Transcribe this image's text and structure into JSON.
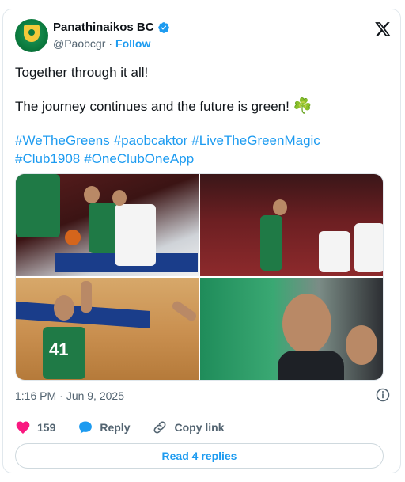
{
  "author": {
    "display_name": "Panathinaikos BC",
    "handle": "@Paobcgr",
    "separator": "·",
    "follow_label": "Follow",
    "avatar_text": "PANATHINAIKOS BC AKTOR",
    "verified_color": "#1d9bf0"
  },
  "tweet": {
    "line1": "Together through it all!",
    "line2": "The journey continues and the future is green!",
    "emoji": "☘️",
    "hashtags_row1": [
      "#WeTheGreens",
      "#paobcaktor",
      "#LiveTheGreenMagic"
    ],
    "hashtags_row2": [
      "#Club1908",
      "#OneClubOneApp"
    ]
  },
  "media": {
    "photos": [
      {
        "alt_icon": "photo-basketball-dribble",
        "jersey": ""
      },
      {
        "alt_icon": "photo-layup",
        "jersey": ""
      },
      {
        "alt_icon": "photo-shot",
        "jersey": "41"
      },
      {
        "alt_icon": "photo-coach",
        "jersey": ""
      }
    ]
  },
  "meta": {
    "time": "1:16 PM",
    "separator": "·",
    "date": "Jun 9, 2025"
  },
  "actions": {
    "like_count": "159",
    "reply_label": "Reply",
    "copy_link_label": "Copy link"
  },
  "footer": {
    "read_replies_label": "Read 4 replies"
  },
  "colors": {
    "accent": "#1d9bf0",
    "like": "#f91880",
    "text": "#0f1419",
    "muted": "#536471"
  }
}
